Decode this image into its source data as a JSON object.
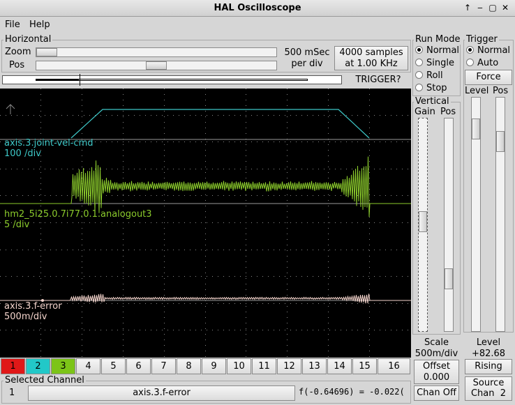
{
  "window": {
    "title": "HAL Oscilloscope"
  },
  "menu": {
    "file": "File",
    "help": "Help"
  },
  "horizontal": {
    "label": "Horizontal",
    "zoom_label": "Zoom",
    "pos_label": "Pos",
    "rate_line1": "500 mSec",
    "rate_line2": "per div",
    "samples_line1": "4000 samples",
    "samples_line2": "at 1.00 KHz",
    "trigger_status": "TRIGGER?"
  },
  "run_mode": {
    "label": "Run Mode",
    "options": [
      "Normal",
      "Single",
      "Roll",
      "Stop"
    ],
    "selected": "Normal"
  },
  "trigger": {
    "label": "Trigger",
    "options": [
      "Normal",
      "Auto"
    ],
    "selected": "Normal",
    "force_label": "Force",
    "level_label": "Level",
    "pos_label": "Pos",
    "level_caption": "Level",
    "level_value": "+82.68",
    "edge_label": "Rising",
    "source_line1": "Source",
    "source_line2": "Chan  2"
  },
  "vertical": {
    "label": "Vertical",
    "gain_label": "Gain",
    "pos_label": "Pos",
    "scale_caption": "Scale",
    "scale_value": "500m/div",
    "offset_caption": "Offset",
    "offset_value": "0.000",
    "chan_off_label": "Chan Off"
  },
  "traces": [
    {
      "name": "axis.3.joint-vel-cmd",
      "scale": "100 /div",
      "color": "#3ec8c8"
    },
    {
      "name": "hm2_5i25.0.7i77.0.1.analogout3",
      "scale": "5 /div",
      "color": "#8ccc2c"
    },
    {
      "name": "axis.3.f-error",
      "scale": "500m/div",
      "color": "#f4d4cc"
    }
  ],
  "channels": [
    {
      "label": "1",
      "color": "#e01818"
    },
    {
      "label": "2",
      "color": "#22c8c8"
    },
    {
      "label": "3",
      "color": "#7cc418"
    },
    {
      "label": "4",
      "color": ""
    },
    {
      "label": "5",
      "color": ""
    },
    {
      "label": "6",
      "color": ""
    },
    {
      "label": "7",
      "color": ""
    },
    {
      "label": "8",
      "color": ""
    },
    {
      "label": "9",
      "color": ""
    },
    {
      "label": "10",
      "color": ""
    },
    {
      "label": "11",
      "color": ""
    },
    {
      "label": "12",
      "color": ""
    },
    {
      "label": "13",
      "color": ""
    },
    {
      "label": "14",
      "color": ""
    },
    {
      "label": "15",
      "color": ""
    },
    {
      "label": "16",
      "color": ""
    }
  ],
  "selected_channel": {
    "label": "Selected Channel",
    "number": "1",
    "name": "axis.3.f-error",
    "readout": "f(-0.64696) = -0.022("
  }
}
